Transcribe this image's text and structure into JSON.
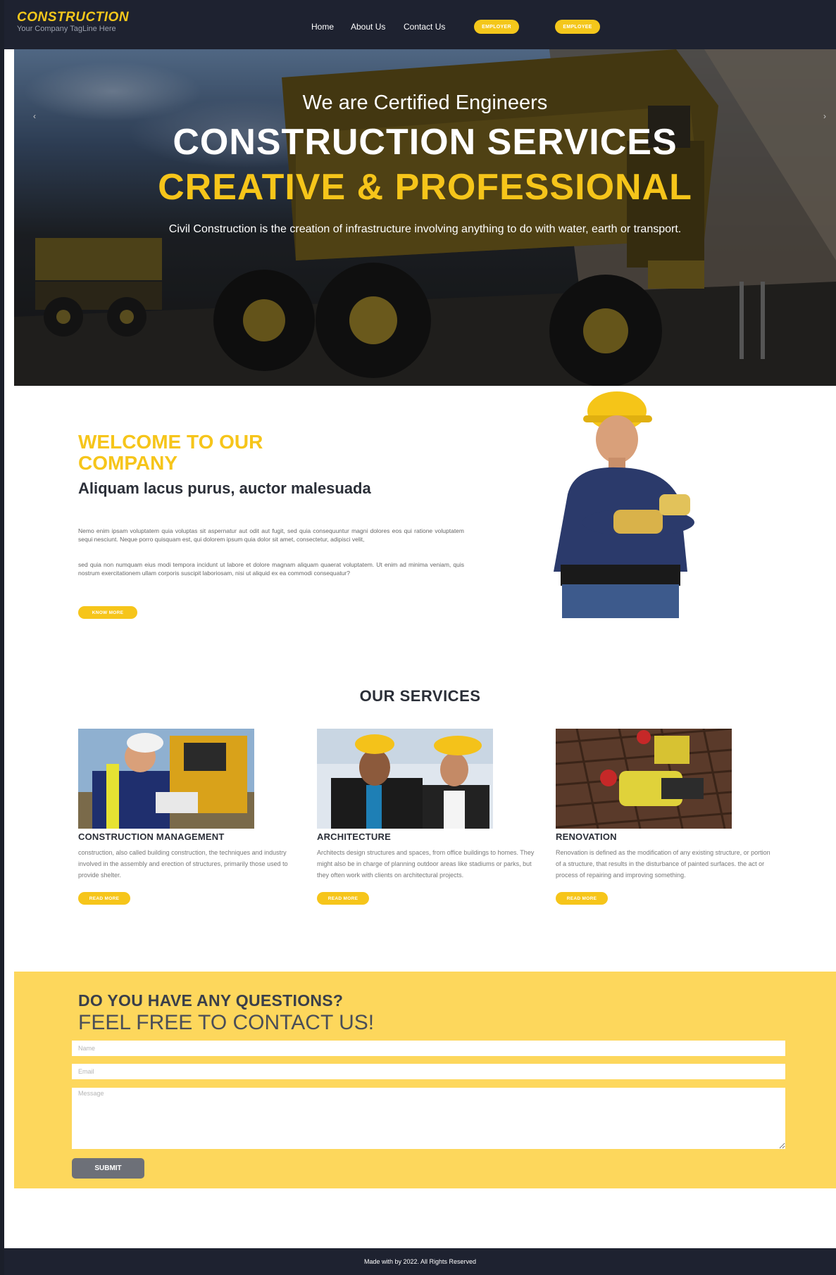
{
  "brand": {
    "name": "CONSTRUCTION",
    "tagline": "Your Company TagLine Here"
  },
  "nav": {
    "links": [
      "Home",
      "About Us",
      "Contact Us"
    ],
    "buttons": [
      "EMPLOYER",
      "EMPLOYEE"
    ]
  },
  "hero": {
    "eyebrow": "We are Certified Engineers",
    "title_line1": "CONSTRUCTION SERVICES",
    "title_line2": "CREATIVE & PROFESSIONAL",
    "description": "Civil Construction is the creation of infrastructure involving anything to do with water, earth or transport."
  },
  "welcome": {
    "title": "WELCOME TO OUR COMPANY",
    "subtitle": "Aliquam lacus purus, auctor malesuada",
    "paragraph1": "Nemo enim ipsam voluptatem quia voluptas sit aspernatur aut odit aut fugit, sed quia consequuntur magni dolores eos qui ratione voluptatem sequi nesciunt. Neque porro quisquam est, qui dolorem ipsum quia dolor sit amet, consectetur, adipisci velit,",
    "paragraph2": "sed quia non numquam eius modi tempora incidunt ut labore et dolore magnam aliquam quaerat voluptatem. Ut enim ad minima veniam, quis nostrum exercitationem ullam corporis suscipit laboriosam, nisi ut aliquid ex ea commodi consequatur?",
    "button": "KNOW MORE"
  },
  "services": {
    "title": "OUR SERVICES",
    "items": [
      {
        "name": "CONSTRUCTION MANAGEMENT",
        "description": "construction, also called building construction, the techniques and industry involved in the assembly and erection of structures, primarily those used to provide shelter.",
        "button": "READ MORE"
      },
      {
        "name": "ARCHITECTURE",
        "description": "Architects design structures and spaces, from office buildings to homes. They might also be in charge of planning outdoor areas like stadiums or parks, but they often work with clients on architectural projects.",
        "button": "READ MORE"
      },
      {
        "name": "RENOVATION",
        "description": "Renovation is defined as the modification of any existing structure, or portion of a structure, that results in the disturbance of painted surfaces. the act or process of repairing and improving something.",
        "button": "READ MORE"
      }
    ]
  },
  "contact": {
    "question": "DO YOU HAVE ANY QUESTIONS?",
    "invite": "FEEL FREE TO CONTACT US!",
    "name_placeholder": "Name",
    "email_placeholder": "Email",
    "message_placeholder": "Message",
    "submit": "SUBMIT"
  },
  "footer": {
    "text": "Made with by 2022. All Rights Reserved"
  },
  "colors": {
    "accent": "#f6c51a",
    "nav_bg": "#1e2230",
    "contact_bg": "#fdd75c"
  }
}
